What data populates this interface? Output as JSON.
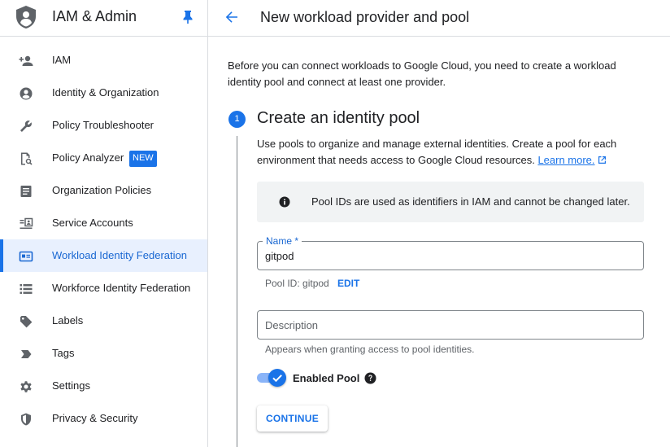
{
  "app": {
    "title": "IAM & Admin"
  },
  "sidebar": {
    "items": [
      {
        "label": "IAM",
        "icon": "person-add-icon"
      },
      {
        "label": "Identity & Organization",
        "icon": "account-circle-icon"
      },
      {
        "label": "Policy Troubleshooter",
        "icon": "wrench-icon"
      },
      {
        "label": "Policy Analyzer",
        "icon": "policy-analyzer-icon",
        "badge": "NEW"
      },
      {
        "label": "Organization Policies",
        "icon": "document-icon"
      },
      {
        "label": "Service Accounts",
        "icon": "service-account-icon"
      },
      {
        "label": "Workload Identity Federation",
        "icon": "id-card-icon",
        "active": true
      },
      {
        "label": "Workforce Identity Federation",
        "icon": "list-icon"
      },
      {
        "label": "Labels",
        "icon": "label-icon"
      },
      {
        "label": "Tags",
        "icon": "tag-icon"
      },
      {
        "label": "Settings",
        "icon": "gear-icon"
      },
      {
        "label": "Privacy & Security",
        "icon": "shield-icon"
      }
    ]
  },
  "header": {
    "title": "New workload provider and pool"
  },
  "main": {
    "intro": "Before you can connect workloads to Google Cloud, you need to create a workload identity pool and connect at least one provider.",
    "step": {
      "number": "1",
      "title": "Create an identity pool",
      "description": "Use pools to organize and manage external identities. Create a pool for each environment that needs access to Google Cloud resources.",
      "learn_more": "Learn more."
    },
    "info": "Pool IDs are used as identifiers in IAM and cannot be changed later.",
    "name_field": {
      "label": "Name *",
      "value": "gitpod"
    },
    "pool_id": "Pool ID: gitpod",
    "edit_label": "EDIT",
    "description_field": {
      "placeholder": "Description",
      "value": ""
    },
    "description_hint": "Appears when granting access to pool identities.",
    "enabled_pool": {
      "label": "Enabled Pool",
      "on": true
    },
    "continue_label": "CONTINUE"
  },
  "colors": {
    "accent": "#1a73e8",
    "active_bg": "#e8f0fe",
    "info_bg": "#f1f3f4"
  }
}
